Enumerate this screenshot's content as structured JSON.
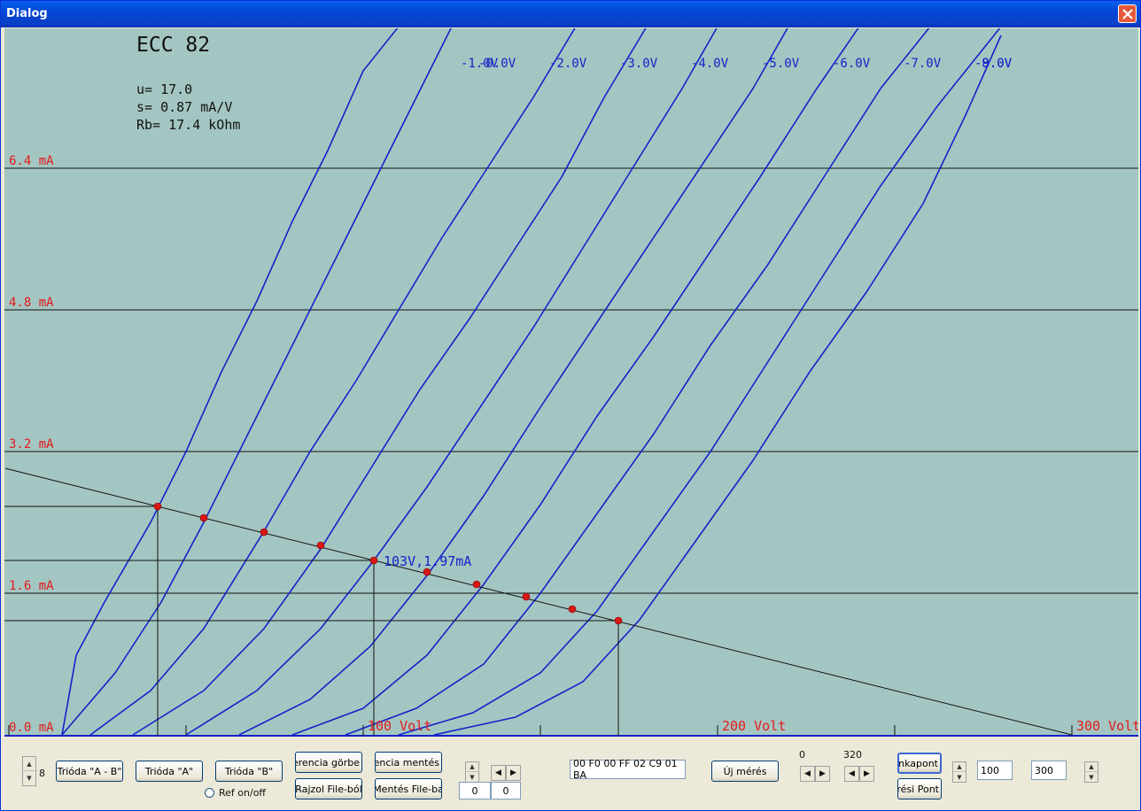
{
  "window": {
    "title": "Dialog"
  },
  "plot": {
    "tube": "ECC 82",
    "params": [
      "u= 17.0",
      "s= 0.87 mA/V",
      "Rb= 17.4 kOhm"
    ],
    "operating_point_label": "103V,1.97mA",
    "colors": {
      "background": "#a4c6c2",
      "curves": "#1522c8",
      "axis_labels": "#e21a1a",
      "points": "#d91818"
    }
  },
  "chart_data": {
    "type": "line",
    "title": "ECC 82",
    "xlabel": "",
    "ylabel": "",
    "x_unit": "Volt",
    "y_unit": "mA",
    "xlim": [
      0,
      320
    ],
    "ylim": [
      0,
      8.0
    ],
    "x_ticks": [
      0,
      50,
      100,
      150,
      200,
      250,
      300
    ],
    "x_tick_labels": [
      "",
      "",
      "100 Volt",
      "",
      "200 Volt",
      "",
      "300 Volt"
    ],
    "y_ticks": [
      0,
      1.6,
      3.2,
      4.8,
      6.4
    ],
    "y_tick_labels": [
      "0.0 mA",
      "1.6 mA",
      "3.2 mA",
      "4.8 mA",
      "6.4 mA"
    ],
    "grid": "horizontal",
    "series": [
      {
        "name": "-0.0V",
        "x": [
          15,
          19,
          27,
          40,
          50,
          60,
          70,
          80,
          90,
          100,
          110,
          120,
          130,
          140
        ],
        "y": [
          0,
          0.9,
          1.5,
          2.4,
          3.2,
          4.1,
          4.9,
          5.8,
          6.6,
          7.5,
          8.0,
          8.0,
          8.0,
          8.0
        ]
      },
      {
        "name": "-1.0V",
        "x": [
          15,
          30,
          43,
          55,
          65,
          75,
          85,
          95,
          105,
          115,
          125,
          135
        ],
        "y": [
          0,
          0.7,
          1.5,
          2.4,
          3.2,
          4.0,
          4.8,
          5.6,
          6.4,
          7.2,
          8.0,
          8.0
        ]
      },
      {
        "name": "-2.0V",
        "x": [
          23,
          40,
          55,
          72,
          85,
          98,
          110,
          122,
          135,
          148,
          160
        ],
        "y": [
          0,
          0.5,
          1.2,
          2.3,
          3.2,
          4.0,
          4.8,
          5.6,
          6.4,
          7.2,
          8.0
        ]
      },
      {
        "name": "-3.0V",
        "x": [
          35,
          55,
          72,
          88,
          102,
          116,
          130,
          143,
          156,
          168,
          180
        ],
        "y": [
          0,
          0.5,
          1.2,
          2.1,
          3.0,
          3.9,
          4.7,
          5.5,
          6.3,
          7.2,
          8.0
        ]
      },
      {
        "name": "-4.0V",
        "x": [
          50,
          70,
          88,
          103,
          118,
          133,
          148,
          162,
          176,
          190,
          200
        ],
        "y": [
          0,
          0.5,
          1.2,
          1.97,
          2.8,
          3.7,
          4.6,
          5.5,
          6.4,
          7.3,
          8.0
        ]
      },
      {
        "name": "-5.0V",
        "x": [
          65,
          85,
          102,
          118,
          134,
          150,
          165,
          180,
          195,
          210,
          220
        ],
        "y": [
          0,
          0.4,
          1.0,
          1.8,
          2.7,
          3.7,
          4.6,
          5.5,
          6.4,
          7.3,
          8.0
        ]
      },
      {
        "name": "-6.0V",
        "x": [
          80,
          100,
          118,
          134,
          150,
          166,
          182,
          197,
          212,
          228,
          240
        ],
        "y": [
          0,
          0.3,
          0.9,
          1.7,
          2.6,
          3.6,
          4.5,
          5.4,
          6.3,
          7.3,
          8.0
        ]
      },
      {
        "name": "-7.0V",
        "x": [
          95,
          115,
          134,
          150,
          166,
          182,
          198,
          214,
          230,
          246,
          260
        ],
        "y": [
          0,
          0.3,
          0.8,
          1.6,
          2.5,
          3.4,
          4.4,
          5.3,
          6.3,
          7.3,
          8.0
        ]
      },
      {
        "name": "-8.0V",
        "x": [
          110,
          131,
          150,
          166,
          182,
          198,
          214,
          230,
          246,
          262,
          280
        ],
        "y": [
          0,
          0.25,
          0.7,
          1.4,
          2.3,
          3.2,
          4.2,
          5.2,
          6.2,
          7.1,
          8.0
        ]
      },
      {
        "name": "-9.0V",
        "x": [
          120,
          143,
          162,
          178,
          194,
          210,
          226,
          242,
          258,
          270,
          280
        ],
        "y": [
          0,
          0.2,
          0.6,
          1.3,
          2.2,
          3.1,
          4.1,
          5.0,
          6.0,
          7.0,
          7.9
        ]
      }
    ],
    "load_line": {
      "x": [
        0,
        300
      ],
      "y": [
        3.0,
        0.0
      ]
    },
    "operating_points": [
      {
        "x": 42,
        "y": 2.58
      },
      {
        "x": 55,
        "y": 2.45
      },
      {
        "x": 72,
        "y": 2.29
      },
      {
        "x": 88,
        "y": 2.14
      },
      {
        "x": 103,
        "y": 1.97
      },
      {
        "x": 118,
        "y": 1.84
      },
      {
        "x": 132,
        "y": 1.7
      },
      {
        "x": 146,
        "y": 1.56
      },
      {
        "x": 159,
        "y": 1.42
      },
      {
        "x": 172,
        "y": 1.29
      }
    ],
    "marked_points": [
      {
        "x": 42,
        "y": 2.58
      },
      {
        "x": 103,
        "y": 1.97
      },
      {
        "x": 172,
        "y": 1.29
      }
    ]
  },
  "controls": {
    "spin_value": "8",
    "btn_trioda_ab": "Trióda \"A - B\"",
    "btn_trioda_a": "Trióda  \"A\"",
    "btn_trioda_b": "Trióda  \"B\"",
    "radio_ref": "Ref on/off",
    "btn_ref_gorbe": "Referencia görbe",
    "btn_ref_mentes": "Referencia mentés",
    "btn_rajzol": "Rajzol File-ból",
    "btn_mentes": "Mentés File-ba",
    "field_left1": "0",
    "field_left2": "0",
    "hex_field": "00 F0 00 FF 02 C9 01 BA",
    "btn_uj_meres": "Új mérés",
    "label_0": "0",
    "label_320": "320",
    "btn_munkapont": "Munkapont",
    "btn_meresi_pont": "Mérési Pont",
    "field_100": "100",
    "field_300": "300"
  }
}
